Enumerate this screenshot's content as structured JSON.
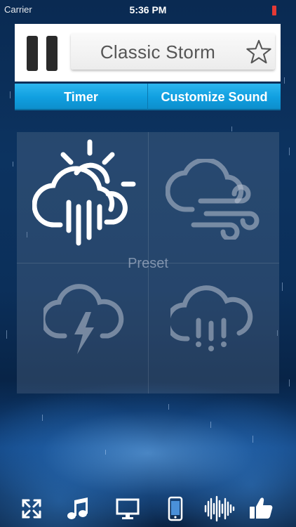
{
  "status_bar": {
    "carrier": "Carrier",
    "time": "5:36 PM",
    "battery_color": "#e53935"
  },
  "player": {
    "state": "playing",
    "pause_icon": "pause-icon",
    "sound_title": "Classic Storm",
    "favorite_icon": "star-outline-icon"
  },
  "tabs": [
    {
      "label": "Timer"
    },
    {
      "label": "Customize Sound"
    }
  ],
  "preset": {
    "label": "Preset",
    "items": [
      {
        "icon": "sun-cloud-rain-icon",
        "selected": true
      },
      {
        "icon": "cloud-wind-icon",
        "selected": false
      },
      {
        "icon": "cloud-lightning-icon",
        "selected": false
      },
      {
        "icon": "cloud-heavy-rain-icon",
        "selected": false
      }
    ]
  },
  "toolbar": {
    "items": [
      {
        "icon": "fullscreen-icon"
      },
      {
        "icon": "music-note-icon"
      },
      {
        "icon": "monitor-icon"
      },
      {
        "icon": "phone-icon"
      },
      {
        "icon": "soundwave-icon"
      },
      {
        "icon": "thumbs-up-icon"
      }
    ]
  },
  "colors": {
    "accent_tab": "#109fe0",
    "player_bg": "#ffffff",
    "title_text": "#555555"
  }
}
